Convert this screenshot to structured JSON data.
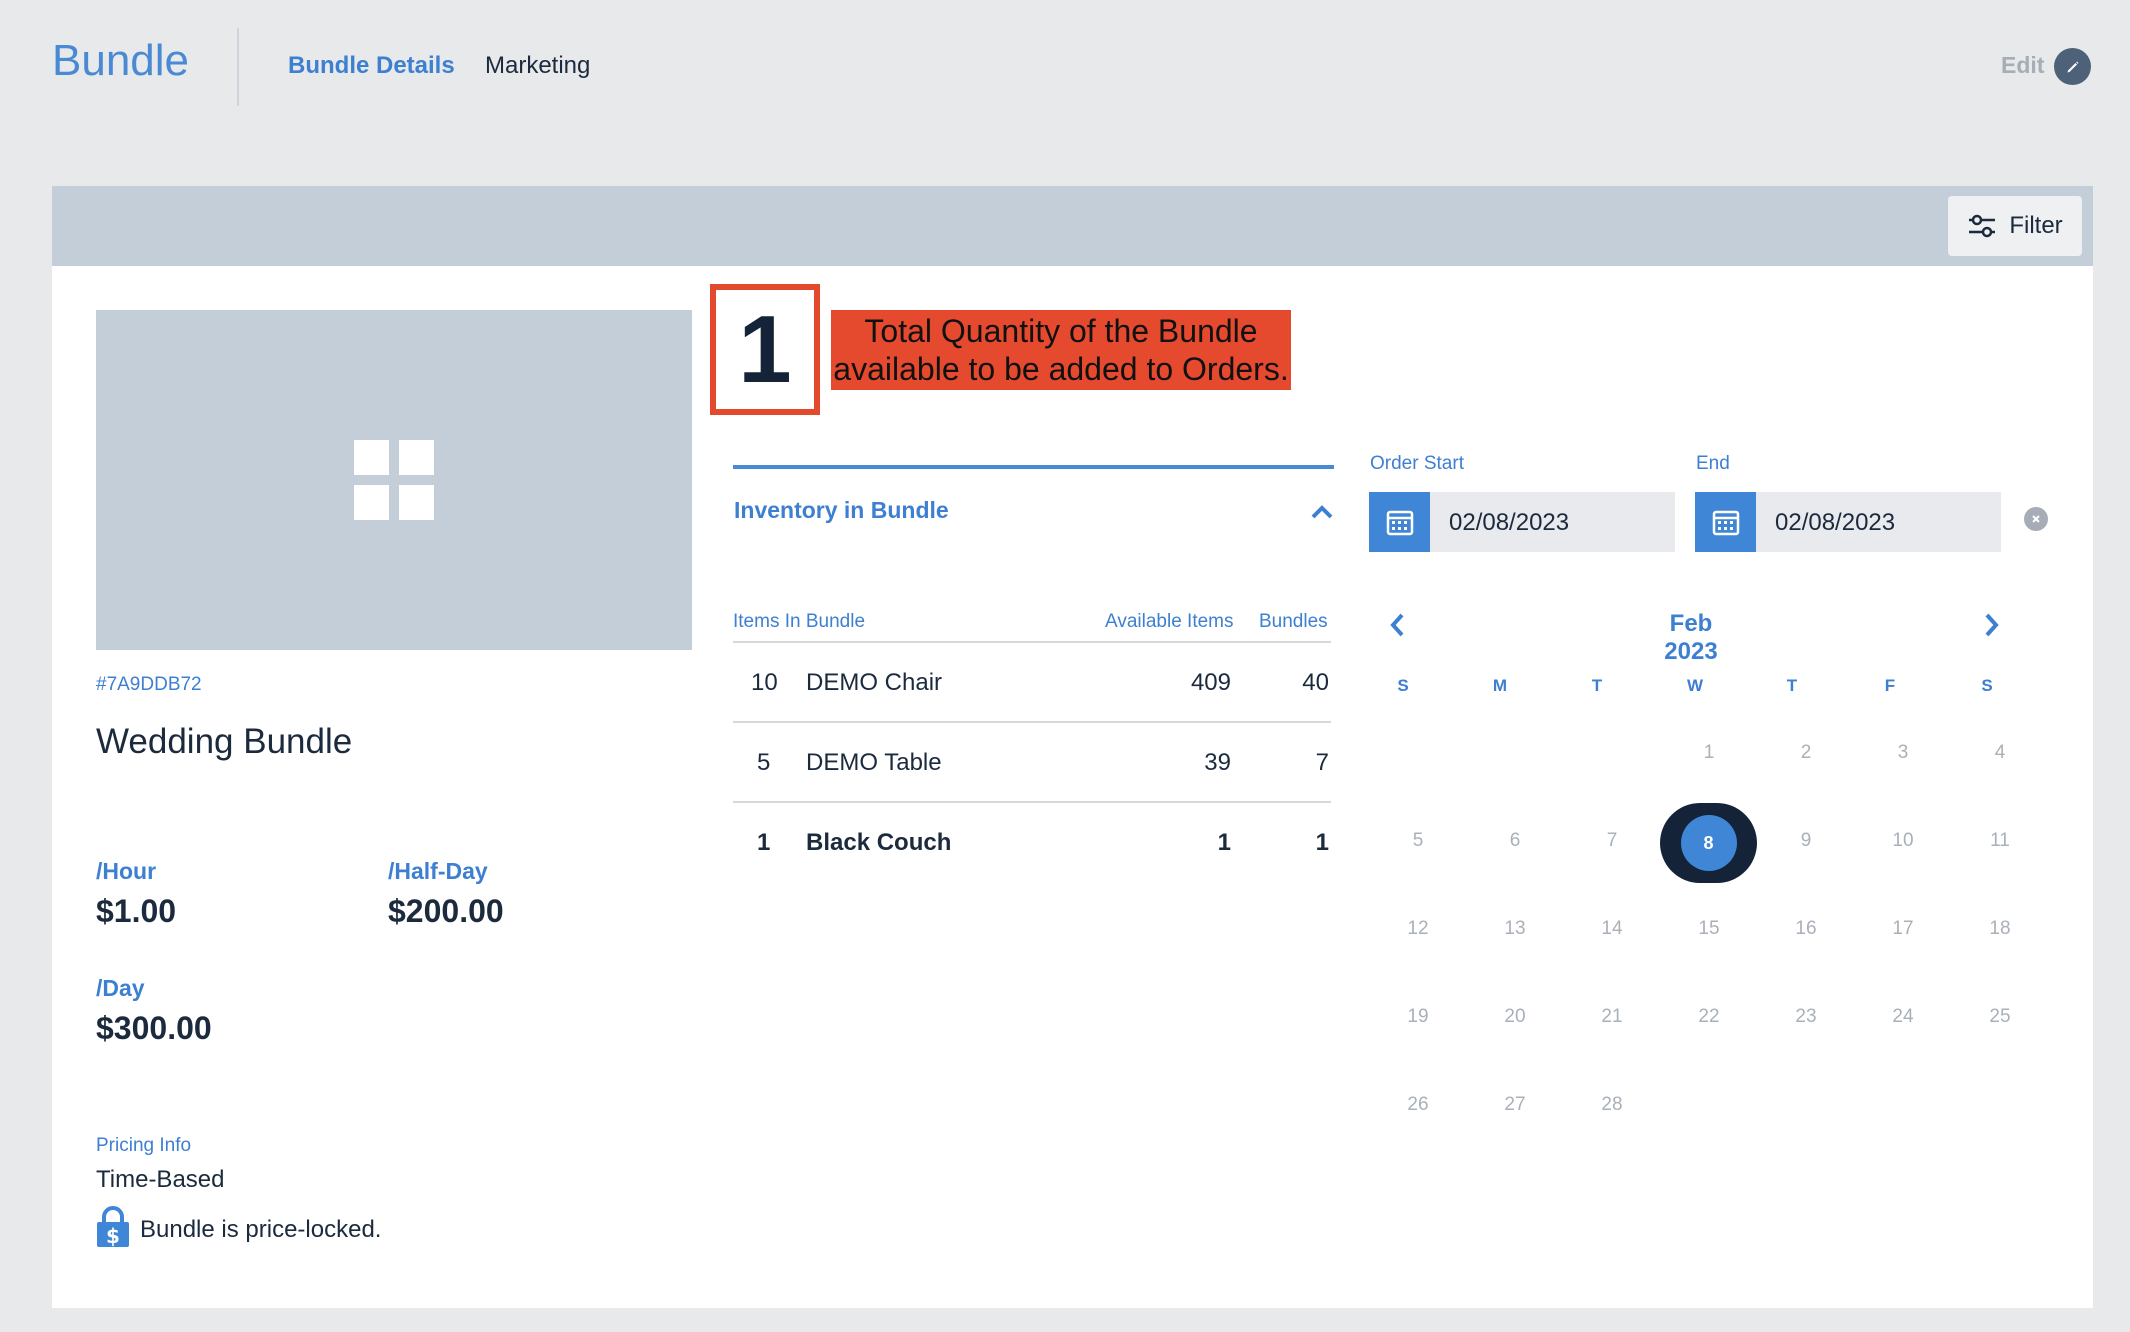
{
  "header": {
    "brand": "Bundle",
    "tabs": [
      {
        "label": "Bundle Details",
        "active": true
      },
      {
        "label": "Marketing",
        "active": false
      }
    ],
    "edit_label": "Edit"
  },
  "toolbar": {
    "filter_label": "Filter"
  },
  "bundle": {
    "sku": "#7A9DDB72",
    "name": "Wedding Bundle",
    "prices": [
      {
        "label": "/Hour",
        "value": "$1.00"
      },
      {
        "label": "/Half-Day",
        "value": "$200.00"
      },
      {
        "label": "/Day",
        "value": "$300.00"
      }
    ],
    "pricing_info_label": "Pricing Info",
    "pricing_info_value": "Time-Based",
    "price_lock_text": "Bundle is price-locked."
  },
  "quantity": {
    "value": "1",
    "callout": [
      "Total Quantity of the Bundle",
      "available to be added to Orders."
    ]
  },
  "inventory": {
    "title": "Inventory in Bundle",
    "columns": [
      "Items In Bundle",
      "Available Items",
      "Bundles"
    ],
    "rows": [
      {
        "qty": "10",
        "name": "DEMO Chair",
        "available": "409",
        "bundles": "40",
        "bold": false
      },
      {
        "qty": "5",
        "name": "DEMO Table",
        "available": "39",
        "bundles": "7",
        "bold": false
      },
      {
        "qty": "1",
        "name": "Black Couch",
        "available": "1",
        "bundles": "1",
        "bold": true
      }
    ]
  },
  "dates": {
    "start_label": "Order Start",
    "start_value": "02/08/2023",
    "end_label": "End",
    "end_value": "02/08/2023"
  },
  "calendar": {
    "title": "Feb 2023",
    "weekdays": [
      "S",
      "M",
      "T",
      "W",
      "T",
      "F",
      "S"
    ],
    "weeks": [
      [
        "",
        "",
        "",
        "1",
        "2",
        "3",
        "4"
      ],
      [
        "5",
        "6",
        "7",
        "8",
        "9",
        "10",
        "11"
      ],
      [
        "12",
        "13",
        "14",
        "15",
        "16",
        "17",
        "18"
      ],
      [
        "19",
        "20",
        "21",
        "22",
        "23",
        "24",
        "25"
      ],
      [
        "26",
        "27",
        "28",
        "",
        "",
        "",
        ""
      ]
    ],
    "selected_day": "8"
  },
  "colors": {
    "accent": "#3d7fd1",
    "dark": "#142338",
    "callout": "#e54a2e"
  }
}
